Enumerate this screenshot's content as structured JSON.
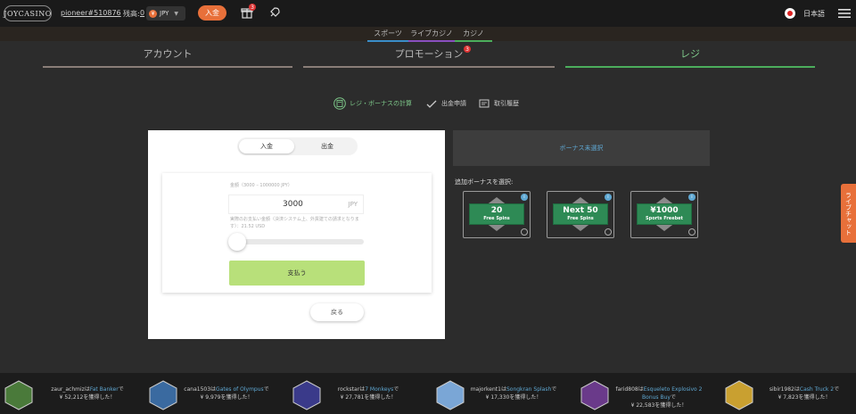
{
  "header": {
    "logo": "JOYCASINO",
    "username": "pioneer#510876",
    "balance_label": "残高:",
    "balance_value": "0",
    "coin_symbol": "¥",
    "currency": "JPY",
    "deposit_label": "入金",
    "gift_count": "3",
    "language": "日本語"
  },
  "subnav": {
    "sports": "スポーツ",
    "live_casino": "ライブカジノ",
    "casino": "カジノ"
  },
  "tabs": {
    "account": "アカウント",
    "promotion": "プロモーション",
    "promotion_badge": "3",
    "cashier": "レジ"
  },
  "cashier_menu": {
    "bonus_calc": "レジ・ボーナスの計算",
    "withdraw_request": "出金申請",
    "history": "取引履歴"
  },
  "panel": {
    "toggle_deposit": "入金",
    "toggle_withdraw": "出金",
    "amount_label": "金額（3000 – 1000000 JPY）",
    "amount_value": "3000",
    "amount_unit": "JPY",
    "amount_note": "実際のお支払い金額（決済システム上、外貨建ての請求となります）：21.52 USD",
    "slider_fraction": 0.0,
    "pay_label": "支払う",
    "back_label": "戻る"
  },
  "bonus": {
    "select_label": "ボーナス未選択",
    "title": "追加ボーナスを選択:",
    "items": [
      {
        "line1": "20",
        "line2": "Free Spins"
      },
      {
        "line1": "Next 50",
        "line2": "Free Spins"
      },
      {
        "line1": "¥1000",
        "line2": "Sports Freebet"
      }
    ],
    "info_glyph": "i"
  },
  "live_chat": "ライブチャット",
  "ticker": [
    {
      "user": "zaur_achmiz",
      "connector": "は",
      "game": "Fat Banker",
      "suffix": "で",
      "amount": "¥ 52,212を獲得した！"
    },
    {
      "user": "cana1503",
      "connector": "は",
      "game": "Gates of Olympus",
      "suffix": "で",
      "amount": "¥ 9,979を獲得した！"
    },
    {
      "user": "rockstar",
      "connector": "は",
      "game": "7 Monkeys",
      "suffix": "で",
      "amount": "¥ 27,781を獲得した！"
    },
    {
      "user": "majorkent1",
      "connector": "は",
      "game": "Songkran Splash",
      "suffix": "で",
      "amount": "¥ 17,330を獲得した！"
    },
    {
      "user": "farid808",
      "connector": "は",
      "game": "Esqueleto Explosivo 2 Bonus Buy",
      "suffix": "で",
      "amount": "¥ 22,583を獲得した！"
    },
    {
      "user": "sibir1982",
      "connector": "は",
      "game": "Cash Truck 2",
      "suffix": "で",
      "amount": "¥ 7,823を獲得した！"
    }
  ],
  "colors": {
    "accent_orange": "#e8703a",
    "accent_green": "#4cae5c",
    "link_blue": "#5fa8d3",
    "pay_green": "#b8e07a",
    "bonus_plate": "#2e8a55"
  }
}
